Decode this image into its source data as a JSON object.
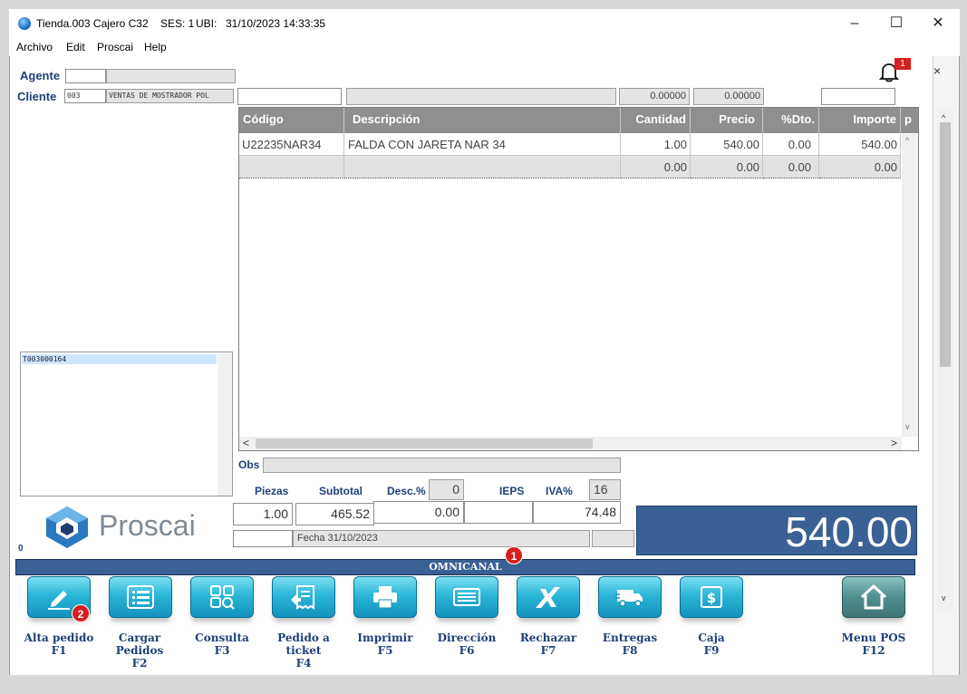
{
  "window": {
    "title": "Tienda.003  Cajero C32",
    "ses": "SES: 1",
    "ubi": "UBI:",
    "datetime": "31/10/2023 14:33:35",
    "minimize": "–",
    "maximize": "☐",
    "close": "✕"
  },
  "menu": [
    "Archivo",
    "Edit",
    "Proscai",
    "Help"
  ],
  "form": {
    "agente_label": "Agente",
    "cliente_label": "Cliente",
    "cliente_code": "003",
    "cliente_name": "VENTAS DE MOSTRADOR POL",
    "value1": "0.00000",
    "value2": "0.00000",
    "close_x": "×",
    "notification_count": "1"
  },
  "grid": {
    "headers": [
      "Código",
      "Descripción",
      "Cantidad",
      "Precio",
      "%Dto.",
      "Importe",
      "p"
    ],
    "rows": [
      [
        "U22235NAR34",
        "FALDA CON JARETA NAR 34",
        "1.00",
        "540.00",
        "0.00",
        "540.00"
      ],
      [
        "",
        "",
        "0.00",
        "0.00",
        "0.00",
        "0.00"
      ]
    ]
  },
  "list": {
    "items": [
      "T003000164"
    ]
  },
  "totals": {
    "obs_label": "Obs",
    "piezas_label": "Piezas",
    "subtotal_label": "Subtotal",
    "desc_label": "Desc.%",
    "desc_pct": "0",
    "ieps_label": "IEPS",
    "iva_label": "IVA%",
    "iva_pct": "16",
    "piezas": "1.00",
    "subtotal": "465.52",
    "descuento": "0.00",
    "ieps": "",
    "iva": "74.48",
    "fecha": "Fecha 31/10/2023",
    "total": "540.00",
    "zero": "0"
  },
  "brand": {
    "name": "Proscai"
  },
  "omnicanal": {
    "label": "OMNICANAL",
    "badge": "1"
  },
  "buttons": [
    {
      "label": "Alta pedido",
      "key": "F1",
      "icon": "pencil-icon",
      "badge": "2"
    },
    {
      "label": "Cargar Pedidos",
      "key": "F2",
      "icon": "list-icon"
    },
    {
      "label": "Consulta",
      "key": "F3",
      "icon": "search-grid-icon"
    },
    {
      "label": "Pedido a ticket",
      "key": "F4",
      "icon": "ticket-icon"
    },
    {
      "label": "Imprimir",
      "key": "F5",
      "icon": "printer-icon"
    },
    {
      "label": "Dirección",
      "key": "F6",
      "icon": "address-icon"
    },
    {
      "label": "Rechazar",
      "key": "F7",
      "icon": "reject-icon"
    },
    {
      "label": "Entregas",
      "key": "F8",
      "icon": "truck-icon"
    },
    {
      "label": "Caja",
      "key": "F9",
      "icon": "cash-icon"
    },
    {
      "label": "Menu POS",
      "key": "F12",
      "icon": "home-icon"
    }
  ],
  "colors": {
    "accent": "#3a6195",
    "button": "#2bb6d8",
    "label": "#1e3f78",
    "badge": "#d71f1f"
  }
}
